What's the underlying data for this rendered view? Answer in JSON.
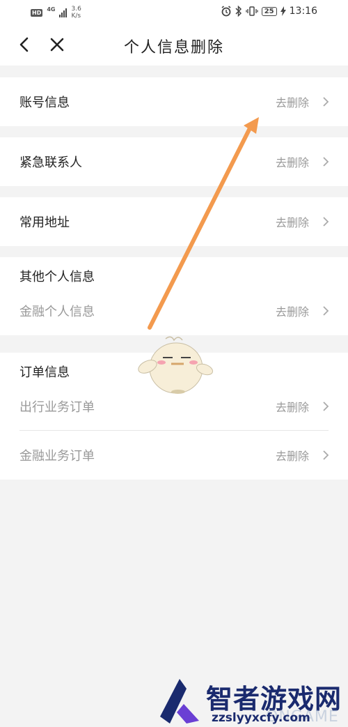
{
  "status_bar": {
    "hd": "HD",
    "network": "4G",
    "speed_value": "3.6",
    "speed_unit": "K/s",
    "battery": "25",
    "time": "13:16"
  },
  "nav": {
    "title": "个人信息删除"
  },
  "sections": {
    "account": {
      "label": "账号信息",
      "action": "去删除"
    },
    "emergency": {
      "label": "紧急联系人",
      "action": "去删除"
    },
    "address": {
      "label": "常用地址",
      "action": "去删除"
    },
    "other_personal": {
      "title": "其他个人信息",
      "items": [
        {
          "label": "金融个人信息",
          "action": "去删除"
        }
      ]
    },
    "orders": {
      "title": "订单信息",
      "items": [
        {
          "label": "出行业务订单",
          "action": "去删除"
        },
        {
          "label": "金融业务订单",
          "action": "去删除"
        }
      ]
    }
  },
  "watermark": {
    "brand": "智者游戏网",
    "faint": "ONGAME",
    "url": "zzslyyxcfy.com"
  },
  "colors": {
    "annotation_arrow": "#f39a4e",
    "action_text": "#9a9a9a",
    "page_bg": "#f3f3f3"
  },
  "icons": [
    "back-arrow-icon",
    "close-icon",
    "chevron-right-icon",
    "alarm-icon",
    "bluetooth-icon",
    "vibrate-icon",
    "charging-icon"
  ]
}
